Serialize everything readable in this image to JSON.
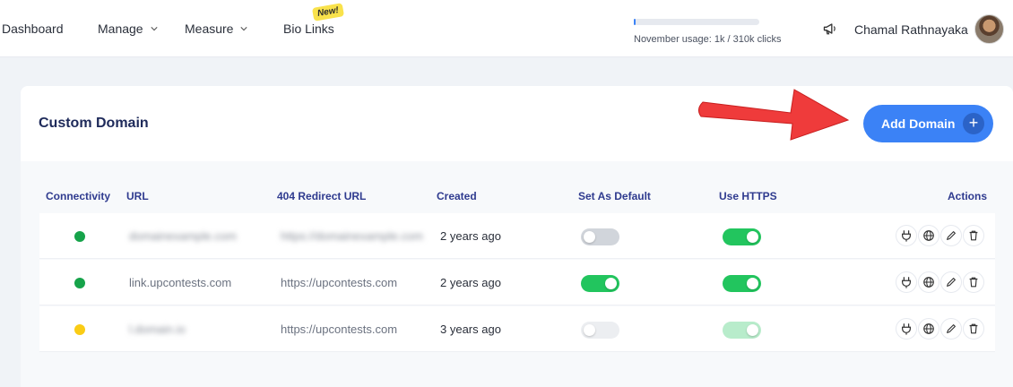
{
  "nav": {
    "items": [
      {
        "label": "Dashboard"
      },
      {
        "label": "Manage"
      },
      {
        "label": "Measure"
      },
      {
        "label": "Bio Links"
      }
    ],
    "new_badge": "New!"
  },
  "usage": {
    "text": "November usage: 1k / 310k clicks",
    "fraction": 0.003
  },
  "user": {
    "name": "Chamal Rathnayaka"
  },
  "card": {
    "title": "Custom Domain",
    "add_button": "Add Domain",
    "add_icon": "+"
  },
  "table": {
    "headers": {
      "connectivity": "Connectivity",
      "url": "URL",
      "redirect": "404 Redirect URL",
      "created": "Created",
      "default": "Set As Default",
      "https": "Use HTTPS",
      "actions": "Actions"
    },
    "rows": [
      {
        "status_color": "#16a34a",
        "url": "blurred",
        "redirect": "blurred",
        "created": "2 years ago",
        "default": false,
        "https": true,
        "disabled": false
      },
      {
        "status_color": "#16a34a",
        "url": "link.upcontests.com",
        "redirect": "https://upcontests.com",
        "created": "2 years ago",
        "default": true,
        "https": true,
        "disabled": false
      },
      {
        "status_color": "#facc15",
        "url": "blurred",
        "redirect": "https://upcontests.com",
        "created": "3 years ago",
        "default": false,
        "https": true,
        "disabled": true
      }
    ],
    "action_icons": [
      "plug-icon",
      "globe-icon",
      "pencil-icon",
      "trash-icon"
    ]
  },
  "colors": {
    "accent": "#3b82f6",
    "toggle_on": "#22c55e",
    "status_ok": "#16a34a",
    "status_warn": "#facc15",
    "arrow": "#ef3b3b"
  }
}
